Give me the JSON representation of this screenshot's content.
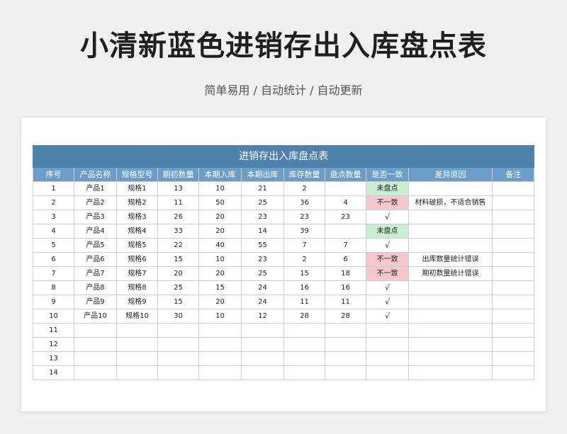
{
  "page": {
    "title": "小清新蓝色进销存出入库盘点表",
    "subtitle": "简单易用 / 自动统计 / 自动更新"
  },
  "sheet": {
    "title": "进销存出入库盘点表",
    "headers": [
      "序号",
      "产品名称",
      "规格型号",
      "期初数量",
      "本期入库",
      "本期出库",
      "库存数量",
      "盘点数量",
      "是否一致",
      "差异原因",
      "备注"
    ],
    "rows": [
      [
        "1",
        "产品1",
        "规格1",
        "13",
        "10",
        "21",
        "2",
        "",
        "未盘点",
        "",
        ""
      ],
      [
        "2",
        "产品2",
        "规格2",
        "11",
        "50",
        "25",
        "36",
        "4",
        "不一致",
        "材料破损，不适合销售",
        ""
      ],
      [
        "3",
        "产品3",
        "规格3",
        "26",
        "20",
        "23",
        "23",
        "23",
        "√",
        "",
        ""
      ],
      [
        "4",
        "产品4",
        "规格4",
        "33",
        "20",
        "14",
        "39",
        "",
        "未盘点",
        "",
        ""
      ],
      [
        "5",
        "产品5",
        "规格5",
        "22",
        "40",
        "55",
        "7",
        "7",
        "√",
        "",
        ""
      ],
      [
        "6",
        "产品6",
        "规格6",
        "15",
        "10",
        "23",
        "2",
        "6",
        "不一致",
        "出库数量统计错误",
        ""
      ],
      [
        "7",
        "产品7",
        "规格7",
        "20",
        "20",
        "25",
        "15",
        "18",
        "不一致",
        "期初数量统计错误",
        ""
      ],
      [
        "8",
        "产品8",
        "规格8",
        "25",
        "15",
        "24",
        "16",
        "16",
        "√",
        "",
        ""
      ],
      [
        "9",
        "产品9",
        "规格9",
        "15",
        "20",
        "24",
        "11",
        "11",
        "√",
        "",
        ""
      ],
      [
        "10",
        "产品10",
        "规格10",
        "30",
        "10",
        "12",
        "28",
        "28",
        "√",
        "",
        ""
      ],
      [
        "11",
        "",
        "",
        "",
        "",
        "",
        "",
        "",
        "",
        "",
        ""
      ],
      [
        "12",
        "",
        "",
        "",
        "",
        "",
        "",
        "",
        "",
        "",
        ""
      ],
      [
        "13",
        "",
        "",
        "",
        "",
        "",
        "",
        "",
        "",
        "",
        ""
      ],
      [
        "14",
        "",
        "",
        "",
        "",
        "",
        "",
        "",
        "",
        "",
        ""
      ]
    ],
    "status_colors": {
      "未盘点": "#c8efcf",
      "不一致": "#f8c6cb"
    },
    "header_color": "#6a9dc9",
    "banner_color": "#4f81ad"
  }
}
